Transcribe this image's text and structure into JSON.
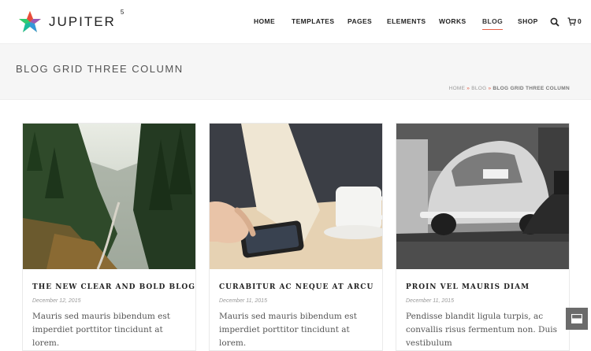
{
  "header": {
    "brand": "JUPITER",
    "brand_sup": "5",
    "nav": [
      {
        "label": "HOME"
      },
      {
        "label": "TEMPLATES"
      },
      {
        "label": "PAGES"
      },
      {
        "label": "ELEMENTS"
      },
      {
        "label": "WORKS"
      },
      {
        "label": "BLOG",
        "active": true
      },
      {
        "label": "SHOP"
      }
    ],
    "icons": {
      "search": "search-icon",
      "cart": "cart-icon"
    },
    "cart_count": "0"
  },
  "title_band": {
    "title": "BLOG GRID THREE COLUMN",
    "breadcrumb": [
      "HOME",
      "BLOG",
      "BLOG GRID THREE COLUMN"
    ],
    "separator": "»"
  },
  "posts": [
    {
      "title": "THE NEW CLEAR AND BOLD BLOG",
      "date": "December 12, 2015",
      "excerpt": "Mauris sed mauris bibendum est imperdiet porttitor tincidunt at lorem.",
      "image": "forest-valley-photo"
    },
    {
      "title": "CURABITUR AC NEQUE AT ARCU",
      "date": "December 11, 2015",
      "excerpt": "Mauris sed mauris bibendum est imperdiet porttitor tincidunt at lorem.",
      "image": "phone-and-coffee-photo"
    },
    {
      "title": "PROIN VEL MAURIS DIAM",
      "date": "December 11, 2015",
      "excerpt": "Pendisse blandit ligula turpis, ac convallis risus fermentum non. Duis vestibulum",
      "image": "vintage-car-garage-photo"
    }
  ],
  "colors": {
    "accent": "#e45f46",
    "title_band": "#f6f6f6",
    "float_button": "#6b6b6b"
  },
  "float_button": {
    "icon": "mail-icon"
  }
}
